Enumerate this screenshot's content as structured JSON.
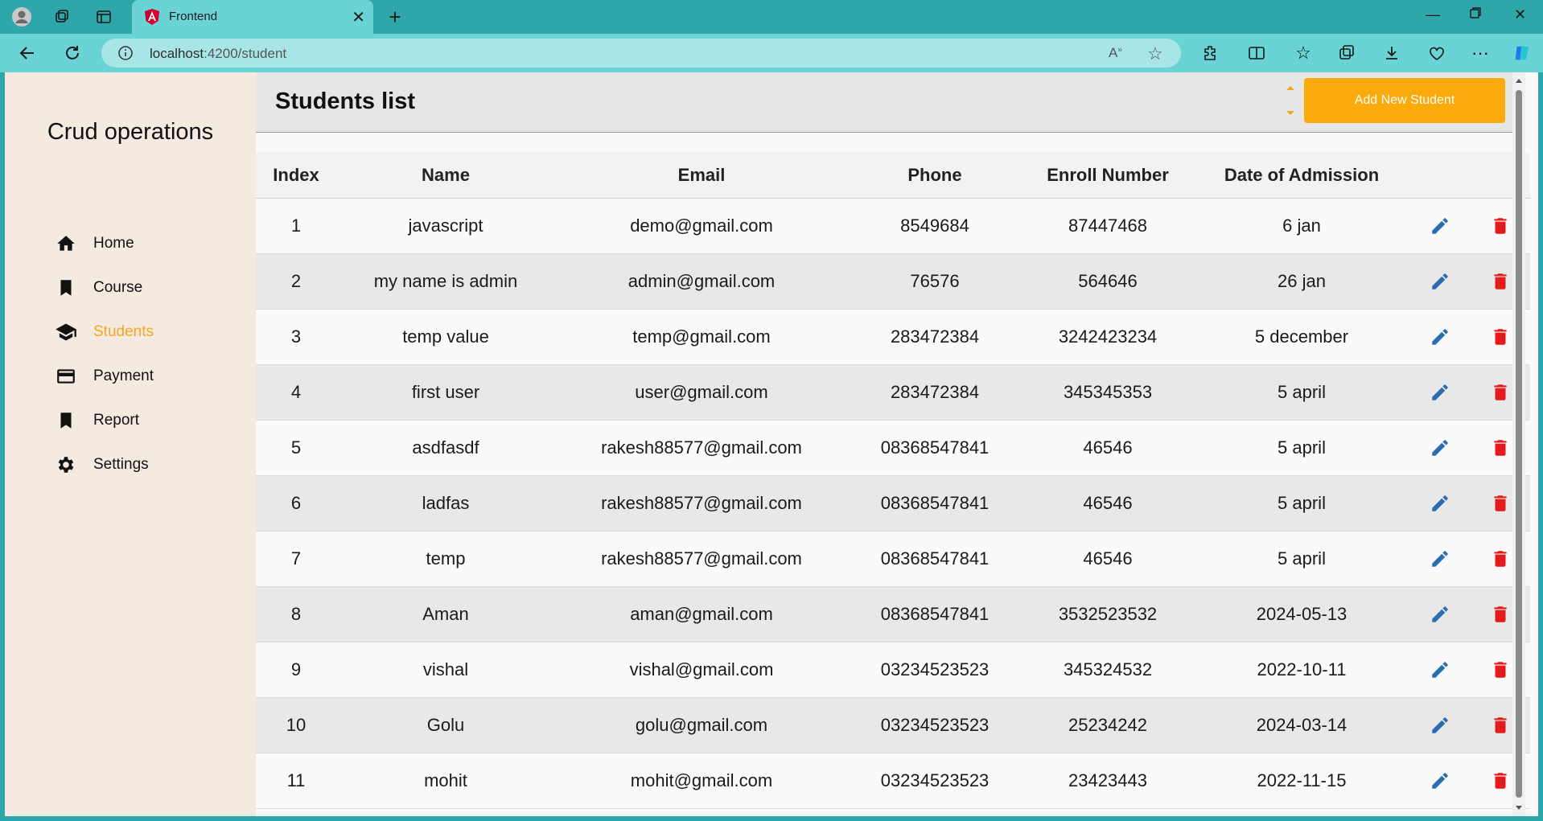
{
  "browser": {
    "tab_title": "Frontend",
    "url_host": "localhost",
    "url_rest": ":4200/student"
  },
  "sidebar": {
    "brand": "Crud operations",
    "items": [
      {
        "label": "Home",
        "icon": "home-icon"
      },
      {
        "label": "Course",
        "icon": "bookmark-icon"
      },
      {
        "label": "Students",
        "icon": "school-icon",
        "active": true
      },
      {
        "label": "Payment",
        "icon": "credit-card-icon"
      },
      {
        "label": "Report",
        "icon": "bookmark-icon"
      },
      {
        "label": "Settings",
        "icon": "gear-icon"
      }
    ]
  },
  "header": {
    "title": "Students list",
    "add_button": "Add New Student"
  },
  "table": {
    "columns": [
      "Index",
      "Name",
      "Email",
      "Phone",
      "Enroll Number",
      "Date of Admission"
    ],
    "rows": [
      [
        "1",
        "javascript",
        "demo@gmail.com",
        "8549684",
        "87447468",
        "6 jan"
      ],
      [
        "2",
        "my name is admin",
        "admin@gmail.com",
        "76576",
        "564646",
        "26 jan"
      ],
      [
        "3",
        "temp value",
        "temp@gmail.com",
        "283472384",
        "3242423234",
        "5 december"
      ],
      [
        "4",
        "first user",
        "user@gmail.com",
        "283472384",
        "345345353",
        "5 april"
      ],
      [
        "5",
        "asdfasdf",
        "rakesh88577@gmail.com",
        "08368547841",
        "46546",
        "5 april"
      ],
      [
        "6",
        "ladfas",
        "rakesh88577@gmail.com",
        "08368547841",
        "46546",
        "5 april"
      ],
      [
        "7",
        "temp",
        "rakesh88577@gmail.com",
        "08368547841",
        "46546",
        "5 april"
      ],
      [
        "8",
        "Aman",
        "aman@gmail.com",
        "08368547841",
        "3532523532",
        "2024-05-13"
      ],
      [
        "9",
        "vishal",
        "vishal@gmail.com",
        "03234523523",
        "345324532",
        "2022-10-11"
      ],
      [
        "10",
        "Golu",
        "golu@gmail.com",
        "03234523523",
        "25234242",
        "2024-03-14"
      ],
      [
        "11",
        "mohit",
        "mohit@gmail.com",
        "03234523523",
        "23423443",
        "2022-11-15"
      ]
    ]
  },
  "colors": {
    "accent": "#fbaa0b",
    "active_nav": "#f5a623",
    "edit_icon": "#2a6db0",
    "delete_icon": "#e31b1b"
  }
}
